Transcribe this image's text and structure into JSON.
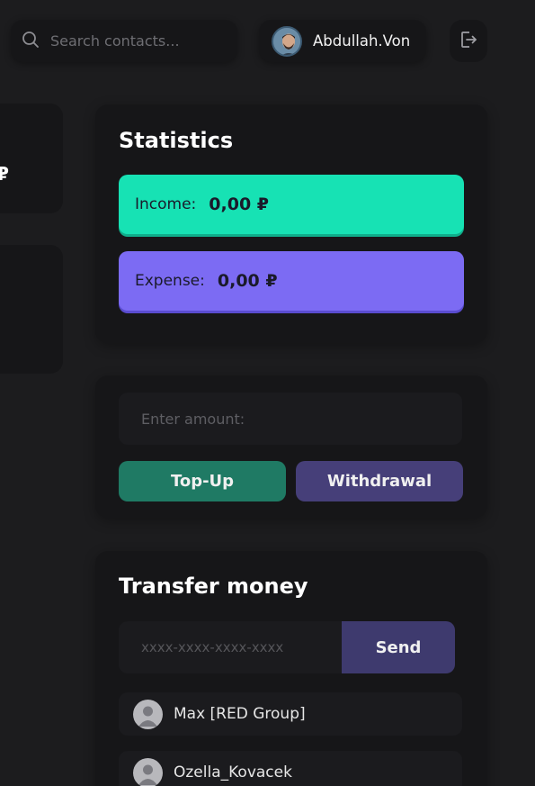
{
  "header": {
    "search_placeholder": "Search contacts...",
    "user_name": "Abdullah.Von"
  },
  "left_partial": {
    "visible_text": "₽"
  },
  "statistics": {
    "title": "Statistics",
    "income_label": "Income:",
    "income_value": "0,00 ₽",
    "expense_label": "Expense:",
    "expense_value": "0,00 ₽",
    "colors": {
      "income": "#17e2b4",
      "expense": "#7c6bf3"
    }
  },
  "balance_actions": {
    "amount_placeholder": "Enter amount:",
    "topup_label": "Top-Up",
    "withdraw_label": "Withdrawal"
  },
  "transfer": {
    "title": "Transfer money",
    "card_placeholder": "xxxx-xxxx-xxxx-xxxx",
    "send_label": "Send",
    "contacts": [
      {
        "name": "Max [RED Group]"
      },
      {
        "name": "Ozella_Kovacek"
      }
    ]
  },
  "icons": {
    "search": "search-icon",
    "logout": "logout-icon",
    "avatar": "user-avatar",
    "cursor": "cursor-icon"
  }
}
